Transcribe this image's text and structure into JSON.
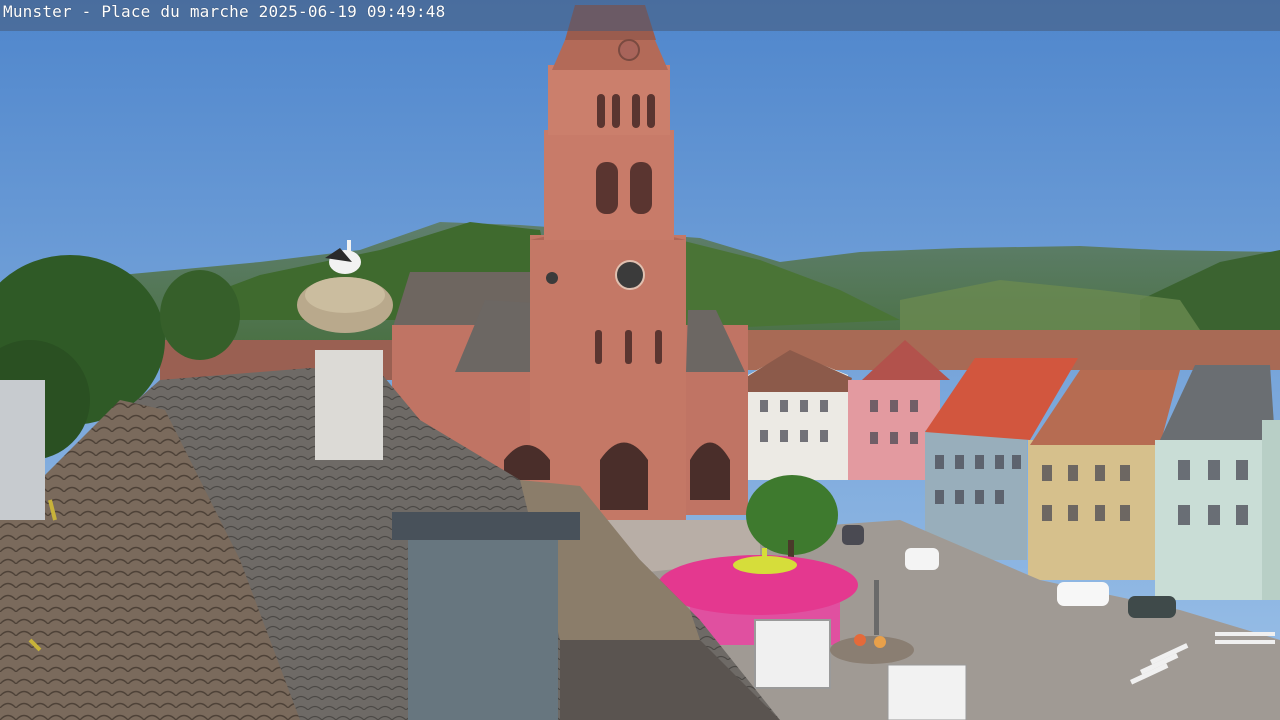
{
  "webcam": {
    "caption": "Munster - Place du marche 2025-06-19 09:49:48"
  },
  "scene": {
    "content": "webcam view over rooftops onto a town square with a red sandstone church tower, hills and houses",
    "sky_color": "#6d9fd6",
    "sandstone_color": "#c07464",
    "roof_color": "#6e6a66",
    "foliage_color": "#3f6a2e",
    "canopy_color": "#e4388f"
  }
}
